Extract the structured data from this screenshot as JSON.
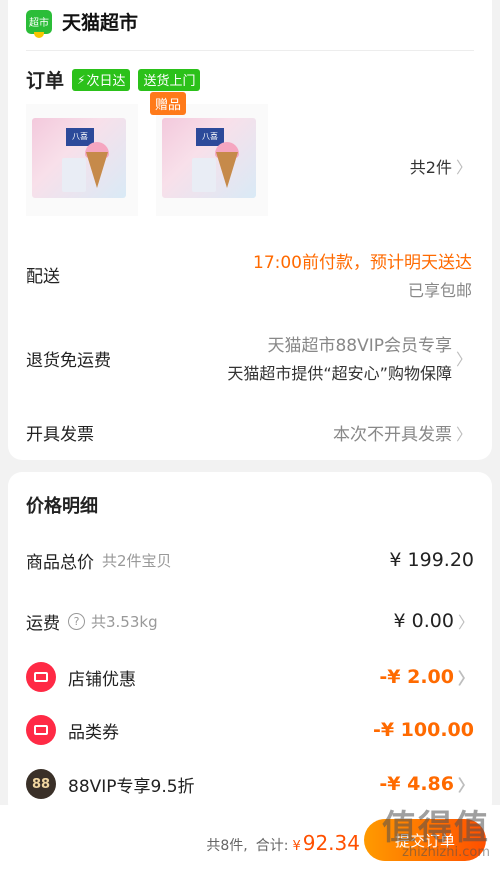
{
  "store": {
    "logo_text": "超市",
    "name": "天猫超市"
  },
  "order": {
    "title": "订单",
    "tags": [
      "次日达",
      "送货上门"
    ],
    "gift_badge": "赠品",
    "product_brand": "八喜",
    "count_label": "共2件"
  },
  "delivery": {
    "label": "配送",
    "promise": "17:00前付款，预计明天送达",
    "shipping": "已享包邮"
  },
  "returns": {
    "label": "退货免运费",
    "line1": "天猫超市88VIP会员专享",
    "line2": "天猫超市提供“超安心”购物保障"
  },
  "invoice": {
    "label": "开具发票",
    "value": "本次不开具发票"
  },
  "price": {
    "title": "价格明细",
    "goods_total": {
      "label": "商品总价",
      "sub": "共2件宝贝",
      "value": "¥ 199.20"
    },
    "freight": {
      "label": "运费",
      "sub": "共3.53kg",
      "value": "¥ 0.00"
    },
    "shop_discount": {
      "label": "店铺优惠",
      "value": "-¥ 2.00"
    },
    "category_coupon": {
      "label": "品类券",
      "value": "-¥ 100.00"
    },
    "vip_discount": {
      "icon_text": "88",
      "label": "88VIP专享9.5折",
      "value": "-¥ 4.86"
    }
  },
  "bottom": {
    "item_count": "共8件,",
    "total_label": "合计:",
    "currency": "¥",
    "total_amount": "92.34",
    "submit_label": "提交订单"
  },
  "watermark": {
    "glyphs": "值得值",
    "site": "zhizhizhi.com"
  },
  "colors": {
    "accent_orange": "#ff6a00",
    "brand_green": "#2bc11a",
    "coupon_red": "#ff2a45"
  }
}
